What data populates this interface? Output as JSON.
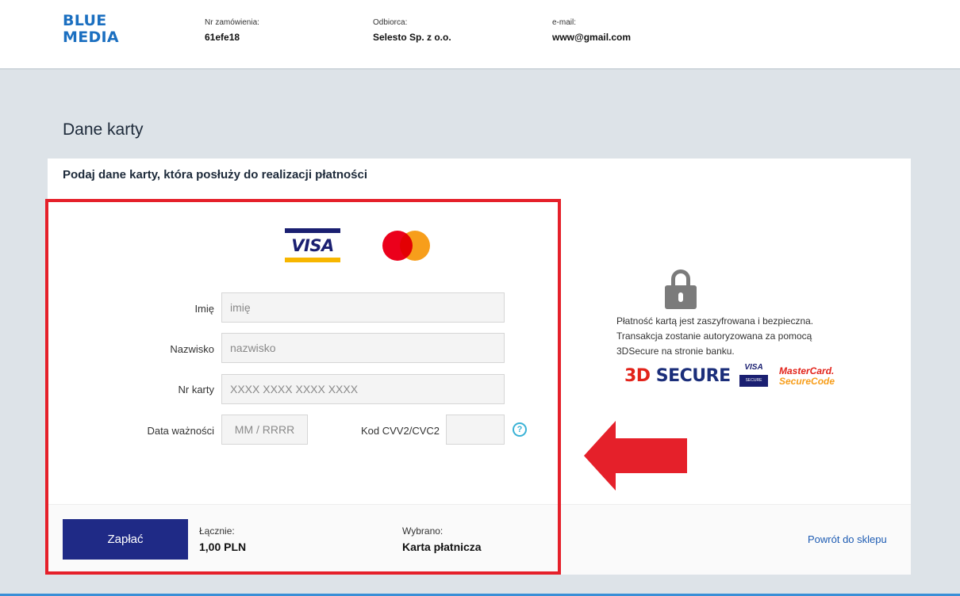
{
  "header": {
    "logo_line1": "BLUE",
    "logo_line2": "MEDIA",
    "order_label": "Nr zamówienia:",
    "order_value": "61efe18",
    "recipient_label": "Odbiorca:",
    "recipient_value": "Selesto Sp. z o.o.",
    "email_label": "e-mail:",
    "email_value": "www@gmail.com"
  },
  "main": {
    "title": "Dane karty",
    "subtitle": "Podaj dane karty, która posłuży do realizacji płatności"
  },
  "brands": {
    "visa_text": "VISA",
    "mastercard_icon": "mastercard-logo"
  },
  "form": {
    "first_name_label": "Imię",
    "first_name_placeholder": "imię",
    "last_name_label": "Nazwisko",
    "last_name_placeholder": "nazwisko",
    "card_number_label": "Nr karty",
    "card_number_placeholder": "XXXX XXXX XXXX XXXX",
    "expiry_label": "Data ważności",
    "expiry_placeholder": "MM / RRRR",
    "cvv_label": "Kod CVV2/CVC2",
    "cvv_placeholder": "",
    "help_glyph": "?"
  },
  "security": {
    "line1": "Płatność kartą jest zaszyfrowana i bezpieczna.",
    "line2": "Transakcja zostanie autoryzowana za pomocą",
    "line3": "3DSecure na stronie banku.",
    "tds_3d": "3D",
    "tds_secure": "SECURE",
    "vbv_top": "VISA",
    "vbv_bottom": "SECURE",
    "mc_line1": "MasterCard.",
    "mc_line2": "SecureCode"
  },
  "footer": {
    "pay_label": "Zapłać",
    "total_label": "Łącznie:",
    "total_value": "1,00 PLN",
    "selected_label": "Wybrano:",
    "selected_value": "Karta płatnicza",
    "back_link": "Powrót do sklepu"
  },
  "colors": {
    "brand_blue": "#1b6fc0",
    "pay_button": "#1f2a86",
    "highlight_red": "#e5202a"
  }
}
